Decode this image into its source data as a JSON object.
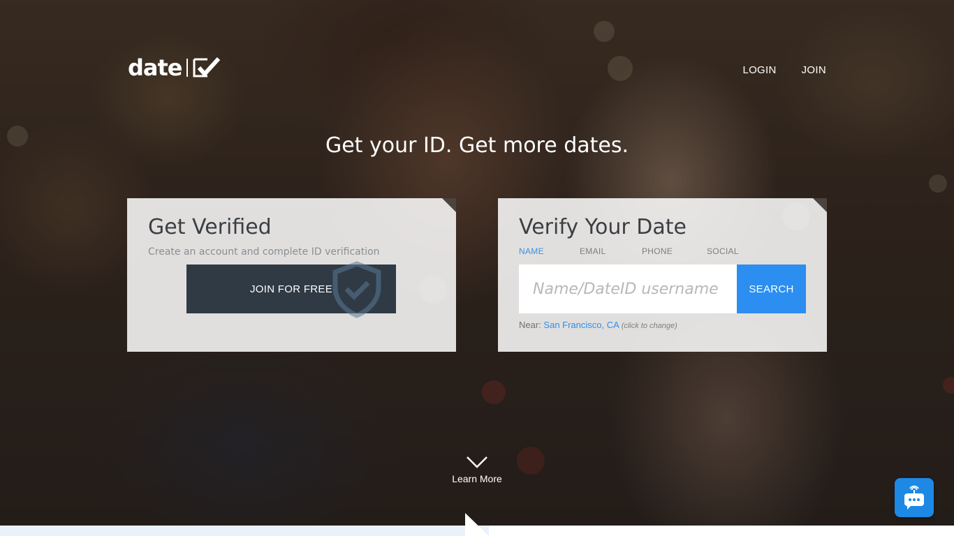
{
  "header": {
    "logo_text": "date",
    "nav": [
      {
        "label": "LOGIN"
      },
      {
        "label": "JOIN"
      }
    ]
  },
  "hero": {
    "headline": "Get your ID. Get more dates."
  },
  "get_verified": {
    "title": "Get Verified",
    "subtitle": "Create an account and complete ID verification",
    "button_label": "JOIN FOR FREE"
  },
  "verify_date": {
    "title": "Verify Your Date",
    "tabs": [
      {
        "label": "NAME",
        "active": true
      },
      {
        "label": "EMAIL",
        "active": false
      },
      {
        "label": "PHONE",
        "active": false
      },
      {
        "label": "SOCIAL",
        "active": false
      }
    ],
    "search_placeholder": "Name/DateID username",
    "search_value": "",
    "search_button_label": "SEARCH",
    "near_label": "Near:",
    "near_location": "San Francisco, CA",
    "near_hint": "(click to change)"
  },
  "learn_more": {
    "label": "Learn More"
  },
  "colors": {
    "accent_blue": "#2b8ef0",
    "dark_button": "#2f3a45",
    "chat_blue": "#1e88e5"
  },
  "icons": {
    "logo_mark": "checkmark-icon",
    "shield": "shield-check-icon",
    "scroll": "chevron-down-icon",
    "chat": "chat-bot-icon"
  }
}
